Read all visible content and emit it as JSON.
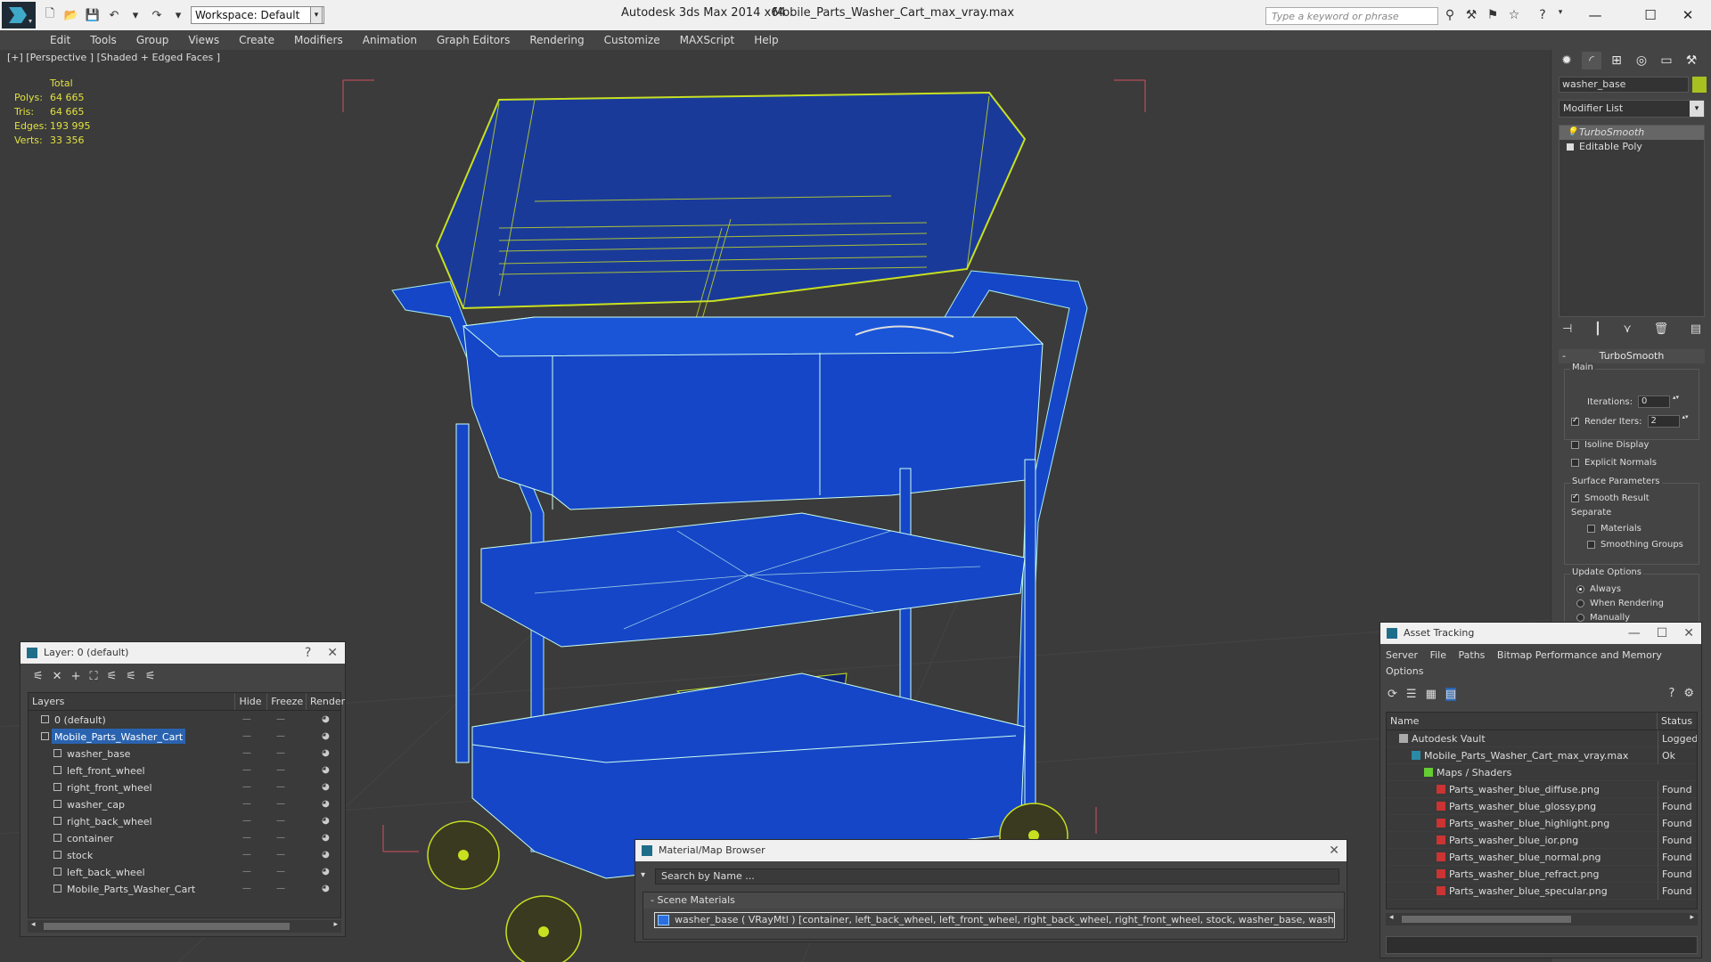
{
  "title": {
    "app": "Autodesk 3ds Max  2014 x64",
    "file": "Mobile_Parts_Washer_Cart_max_vray.max",
    "workspace": "Workspace: Default",
    "search_placeholder": "Type a keyword or phrase"
  },
  "menu": [
    "Edit",
    "Tools",
    "Group",
    "Views",
    "Create",
    "Modifiers",
    "Animation",
    "Graph Editors",
    "Rendering",
    "Customize",
    "MAXScript",
    "Help"
  ],
  "viewport": {
    "label": "[+] [Perspective ] [Shaded + Edged Faces ]",
    "stats": {
      "header": "Total",
      "rows": [
        {
          "key": "Polys:",
          "value": "64 665"
        },
        {
          "key": "Tris:",
          "value": "64 665"
        },
        {
          "key": "Edges:",
          "value": "193 995"
        },
        {
          "key": "Verts:",
          "value": "33 356"
        }
      ]
    }
  },
  "command_panel": {
    "object_name": "washer_base",
    "object_color": "#a8c020",
    "modifier_list": "Modifier List",
    "stack": [
      "TurboSmooth",
      "Editable Poly"
    ],
    "rollout": "TurboSmooth",
    "main_group": "Main",
    "iterations_label": "Iterations:",
    "iterations_value": "0",
    "render_iters_label": "Render Iters:",
    "render_iters_value": "2",
    "isoline": "Isoline Display",
    "explicit_normals": "Explicit Normals",
    "surface_group": "Surface Parameters",
    "smooth_result": "Smooth Result",
    "separate": "Separate",
    "materials": "Materials",
    "smoothing_groups": "Smoothing Groups",
    "update_group": "Update Options",
    "always": "Always",
    "when_rendering": "When Rendering",
    "manually": "Manually"
  },
  "layer_window": {
    "title": "Layer: 0 (default)",
    "help": "?",
    "columns": [
      "Layers",
      "Hide",
      "Freeze",
      "Render"
    ],
    "rows": [
      {
        "name": "0 (default)",
        "level": 1
      },
      {
        "name": "Mobile_Parts_Washer_Cart",
        "level": 1
      },
      {
        "name": "washer_base",
        "level": 2
      },
      {
        "name": "left_front_wheel",
        "level": 2
      },
      {
        "name": "right_front_wheel",
        "level": 2
      },
      {
        "name": "washer_cap",
        "level": 2
      },
      {
        "name": "right_back_wheel",
        "level": 2
      },
      {
        "name": "container",
        "level": 2
      },
      {
        "name": "stock",
        "level": 2
      },
      {
        "name": "left_back_wheel",
        "level": 2
      },
      {
        "name": "Mobile_Parts_Washer_Cart",
        "level": 2
      }
    ]
  },
  "material_browser": {
    "title": "Material/Map Browser",
    "search": "Search by Name ...",
    "section": "- Scene Materials",
    "item": "washer_base  ( VRayMtl )  [container, left_back_wheel, left_front_wheel, right_back_wheel, right_front_wheel, stock, washer_base, washer_cap]"
  },
  "asset_tracking": {
    "title": "Asset Tracking",
    "menu": [
      "Server",
      "File",
      "Paths",
      "Bitmap Performance and Memory",
      "Options"
    ],
    "columns": [
      "Name",
      "Status"
    ],
    "rows": [
      {
        "name": "Autodesk Vault",
        "status": "Logged O",
        "indent": 1,
        "icon": "vault"
      },
      {
        "name": "Mobile_Parts_Washer_Cart_max_vray.max",
        "status": "Ok",
        "indent": 2,
        "icon": "max"
      },
      {
        "name": "Maps / Shaders",
        "status": "",
        "indent": 3,
        "icon": "maps"
      },
      {
        "name": "Parts_washer_blue_diffuse.png",
        "status": "Found",
        "indent": 4,
        "icon": "png"
      },
      {
        "name": "Parts_washer_blue_glossy.png",
        "status": "Found",
        "indent": 4,
        "icon": "png"
      },
      {
        "name": "Parts_washer_blue_highlight.png",
        "status": "Found",
        "indent": 4,
        "icon": "png"
      },
      {
        "name": "Parts_washer_blue_ior.png",
        "status": "Found",
        "indent": 4,
        "icon": "png"
      },
      {
        "name": "Parts_washer_blue_normal.png",
        "status": "Found",
        "indent": 4,
        "icon": "png"
      },
      {
        "name": "Parts_washer_blue_refract.png",
        "status": "Found",
        "indent": 4,
        "icon": "png"
      },
      {
        "name": "Parts_washer_blue_specular.png",
        "status": "Found",
        "indent": 4,
        "icon": "png"
      }
    ]
  },
  "colors": {
    "model_blue": "#1546c8",
    "wire_yellow": "#c8e020",
    "selection": "#2a63b0"
  }
}
